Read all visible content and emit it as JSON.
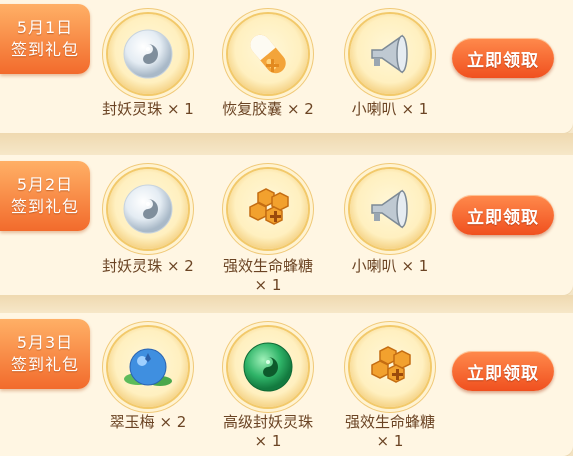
{
  "rows": [
    {
      "date": "5月1日",
      "title": "签到礼包",
      "button": "立即领取",
      "items": [
        {
          "icon": "pearl-orb-icon",
          "name": "封妖灵珠",
          "qty": "× 1"
        },
        {
          "icon": "capsule-icon",
          "name": "恢复胶囊",
          "qty": "× 2"
        },
        {
          "icon": "horn-icon",
          "name": "小喇叭",
          "qty": "× 1"
        }
      ]
    },
    {
      "date": "5月2日",
      "title": "签到礼包",
      "button": "立即领取",
      "items": [
        {
          "icon": "pearl-orb-icon",
          "name": "封妖灵珠",
          "qty": "× 2"
        },
        {
          "icon": "honeycomb-candy-icon",
          "name": "强效生命蜂糖",
          "qty": "× 1"
        },
        {
          "icon": "horn-icon",
          "name": "小喇叭",
          "qty": "× 1"
        }
      ]
    },
    {
      "date": "5月3日",
      "title": "签到礼包",
      "button": "立即领取",
      "items": [
        {
          "icon": "jade-plum-icon",
          "name": "翠玉梅",
          "qty": "× 2"
        },
        {
          "icon": "green-orb-icon",
          "name": "高级封妖灵珠",
          "qty": "× 1"
        },
        {
          "icon": "honeycomb-candy-icon",
          "name": "强效生命蜂糖",
          "qty": "× 1"
        }
      ]
    }
  ],
  "colors": {
    "button": "#f0501f",
    "tag": "#f26b2c",
    "card": "#fff6e3",
    "text": "#6b4424"
  }
}
